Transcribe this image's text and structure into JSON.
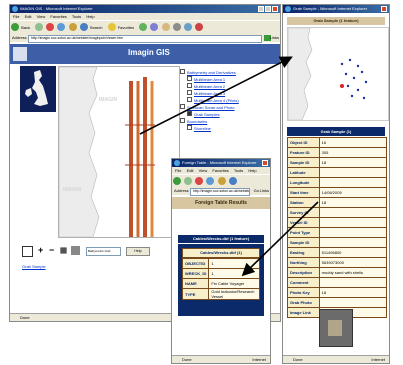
{
  "main_window": {
    "title": "IMAGIN GIS - Microsoft Internet Explorer",
    "menu": [
      "File",
      "Edit",
      "View",
      "Favorites",
      "Tools",
      "Help"
    ],
    "toolbar": {
      "back": "Back",
      "search": "Search",
      "favorites": "Favorites"
    },
    "address": {
      "label": "Address",
      "url": "http://imagin.soc.soton.ac.uk/website/imaginpub/viewer.htm",
      "links": "Links"
    },
    "app_title": "Imagin GIS",
    "map_labels": [
      "IMAGIN",
      "IMAGIN",
      "IMAGIN"
    ],
    "layers": [
      "Bathymetry and Derivatives",
      "Multibeam Area 1",
      "Multibeam Area 2",
      "Multibeam Area 3",
      "Multibeam Area 4 (Pilots)",
      "Sidescan Sonar and Photo",
      "Grab Samples",
      "Boundaries",
      "Shoreline"
    ],
    "bottom_select_value": "Bathymetric Grid",
    "bottom_button": "Help",
    "result_link": "Grab Sample",
    "status": "Done"
  },
  "right_window": {
    "title": "Grab Sample - Microsoft Internet Explorer",
    "header": "Grab Sample (1 feature)",
    "table_title": "Grab Sample (1)",
    "fields": [
      "Object ID",
      "Feature ID",
      "Sample ID",
      "Latitude",
      "Longitude",
      "Start time",
      "Station",
      "Survey ID",
      "Vessel ID",
      "Point Type",
      "Sample ID",
      "Easting",
      "Northing",
      "Description",
      "Comment",
      "Photo Key",
      "Grab Photo",
      "Image Link"
    ],
    "values": [
      "16",
      "305",
      "18",
      "",
      "",
      "14/06/2005",
      "18",
      "",
      "",
      "",
      "",
      "511496800",
      "5639073000",
      "muddy sand with shells",
      "",
      "18",
      "",
      ""
    ],
    "status": "Done",
    "zone": "Internet"
  },
  "feature_window": {
    "title": "Foreign Table - Microsoft Internet Explorer",
    "menu": [
      "File",
      "Edit",
      "View",
      "Favorites",
      "Tools",
      "Help"
    ],
    "address_label": "Address",
    "url": "http://imagin.soc.soton.ac.uk/website/imaginpub/viewer.htm",
    "go": "Go",
    "links": "Links",
    "heading": "Foreign Table Results",
    "outer_title": "Cables/Wrecks.dbf (1 feature)",
    "inner_title": "Cables/Wrecks.dbf (1)",
    "rows": [
      {
        "key": "OBJECTID",
        "value": "1"
      },
      {
        "key": "WRECK_ID",
        "value": "1"
      },
      {
        "key": "NAME",
        "value": "Fin Cable Voyager"
      },
      {
        "key": "TYPE",
        "value": "Gold Indicator/Research Vessel"
      }
    ],
    "status": "Done",
    "zone": "Internet"
  },
  "colors": {
    "titlebar": "#0a246a",
    "navy_header": "#0a2a6a",
    "key_cell": "#f7efc9",
    "value_cell": "#fffbe8",
    "land": "#ececec",
    "survey_track": "#c0502a"
  }
}
